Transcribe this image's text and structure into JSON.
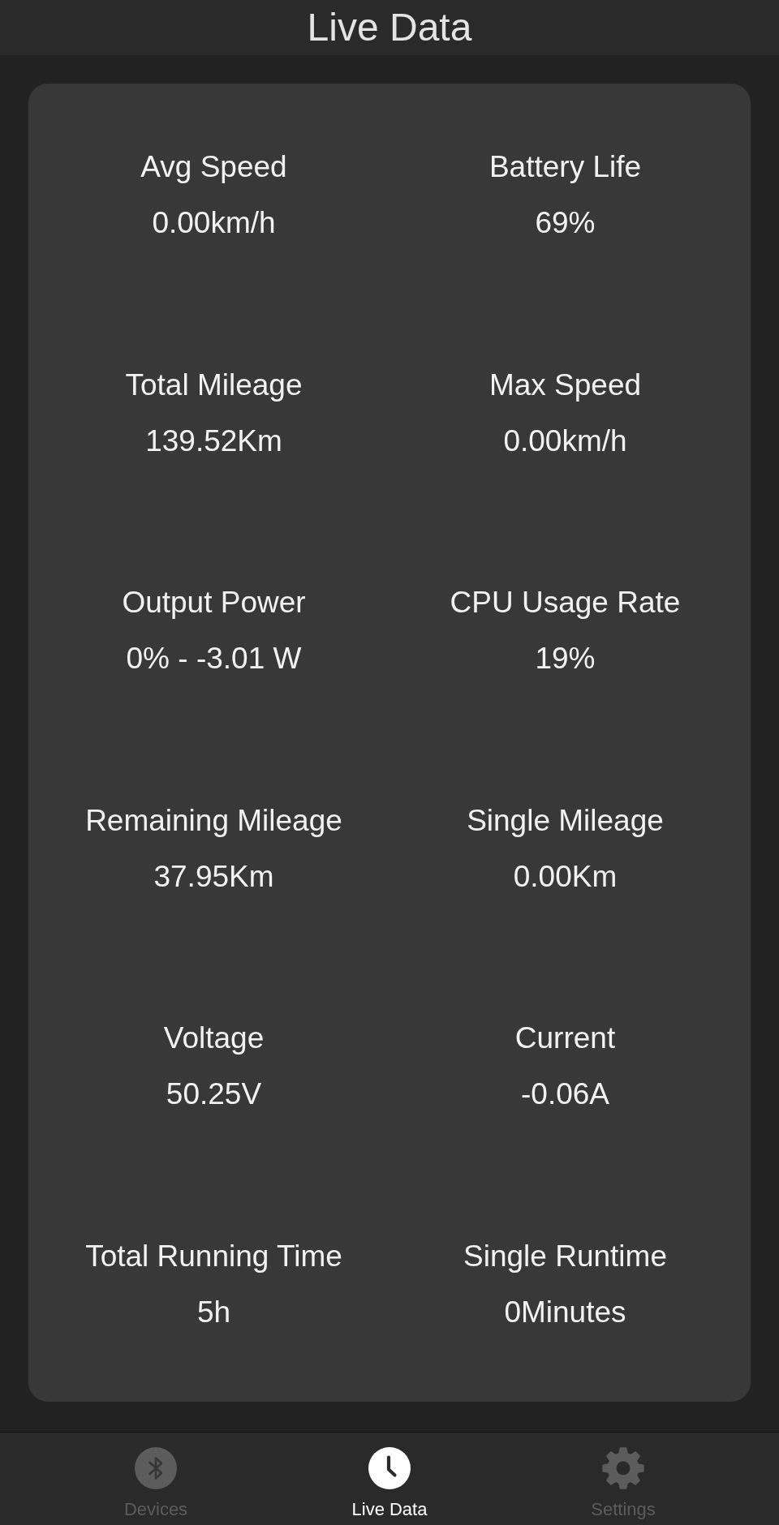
{
  "header": {
    "title": "Live Data"
  },
  "stats": [
    {
      "label": "Avg Speed",
      "value": "0.00km/h"
    },
    {
      "label": "Battery Life",
      "value": "69%"
    },
    {
      "label": "Total Mileage",
      "value": "139.52Km"
    },
    {
      "label": "Max Speed",
      "value": "0.00km/h"
    },
    {
      "label": "Output Power",
      "value": "0% - -3.01 W"
    },
    {
      "label": "CPU Usage Rate",
      "value": "19%"
    },
    {
      "label": "Remaining Mileage",
      "value": "37.95Km"
    },
    {
      "label": "Single Mileage",
      "value": "0.00Km"
    },
    {
      "label": "Voltage",
      "value": "50.25V"
    },
    {
      "label": "Current",
      "value": "-0.06A"
    },
    {
      "label": "Total Running Time",
      "value": "5h"
    },
    {
      "label": "Single Runtime",
      "value": "0Minutes"
    }
  ],
  "nav": [
    {
      "kind": "bluetooth",
      "label": "Devices",
      "selected": false
    },
    {
      "kind": "clock",
      "label": "Live Data",
      "selected": true
    },
    {
      "kind": "gear",
      "label": "Settings",
      "selected": false
    }
  ]
}
